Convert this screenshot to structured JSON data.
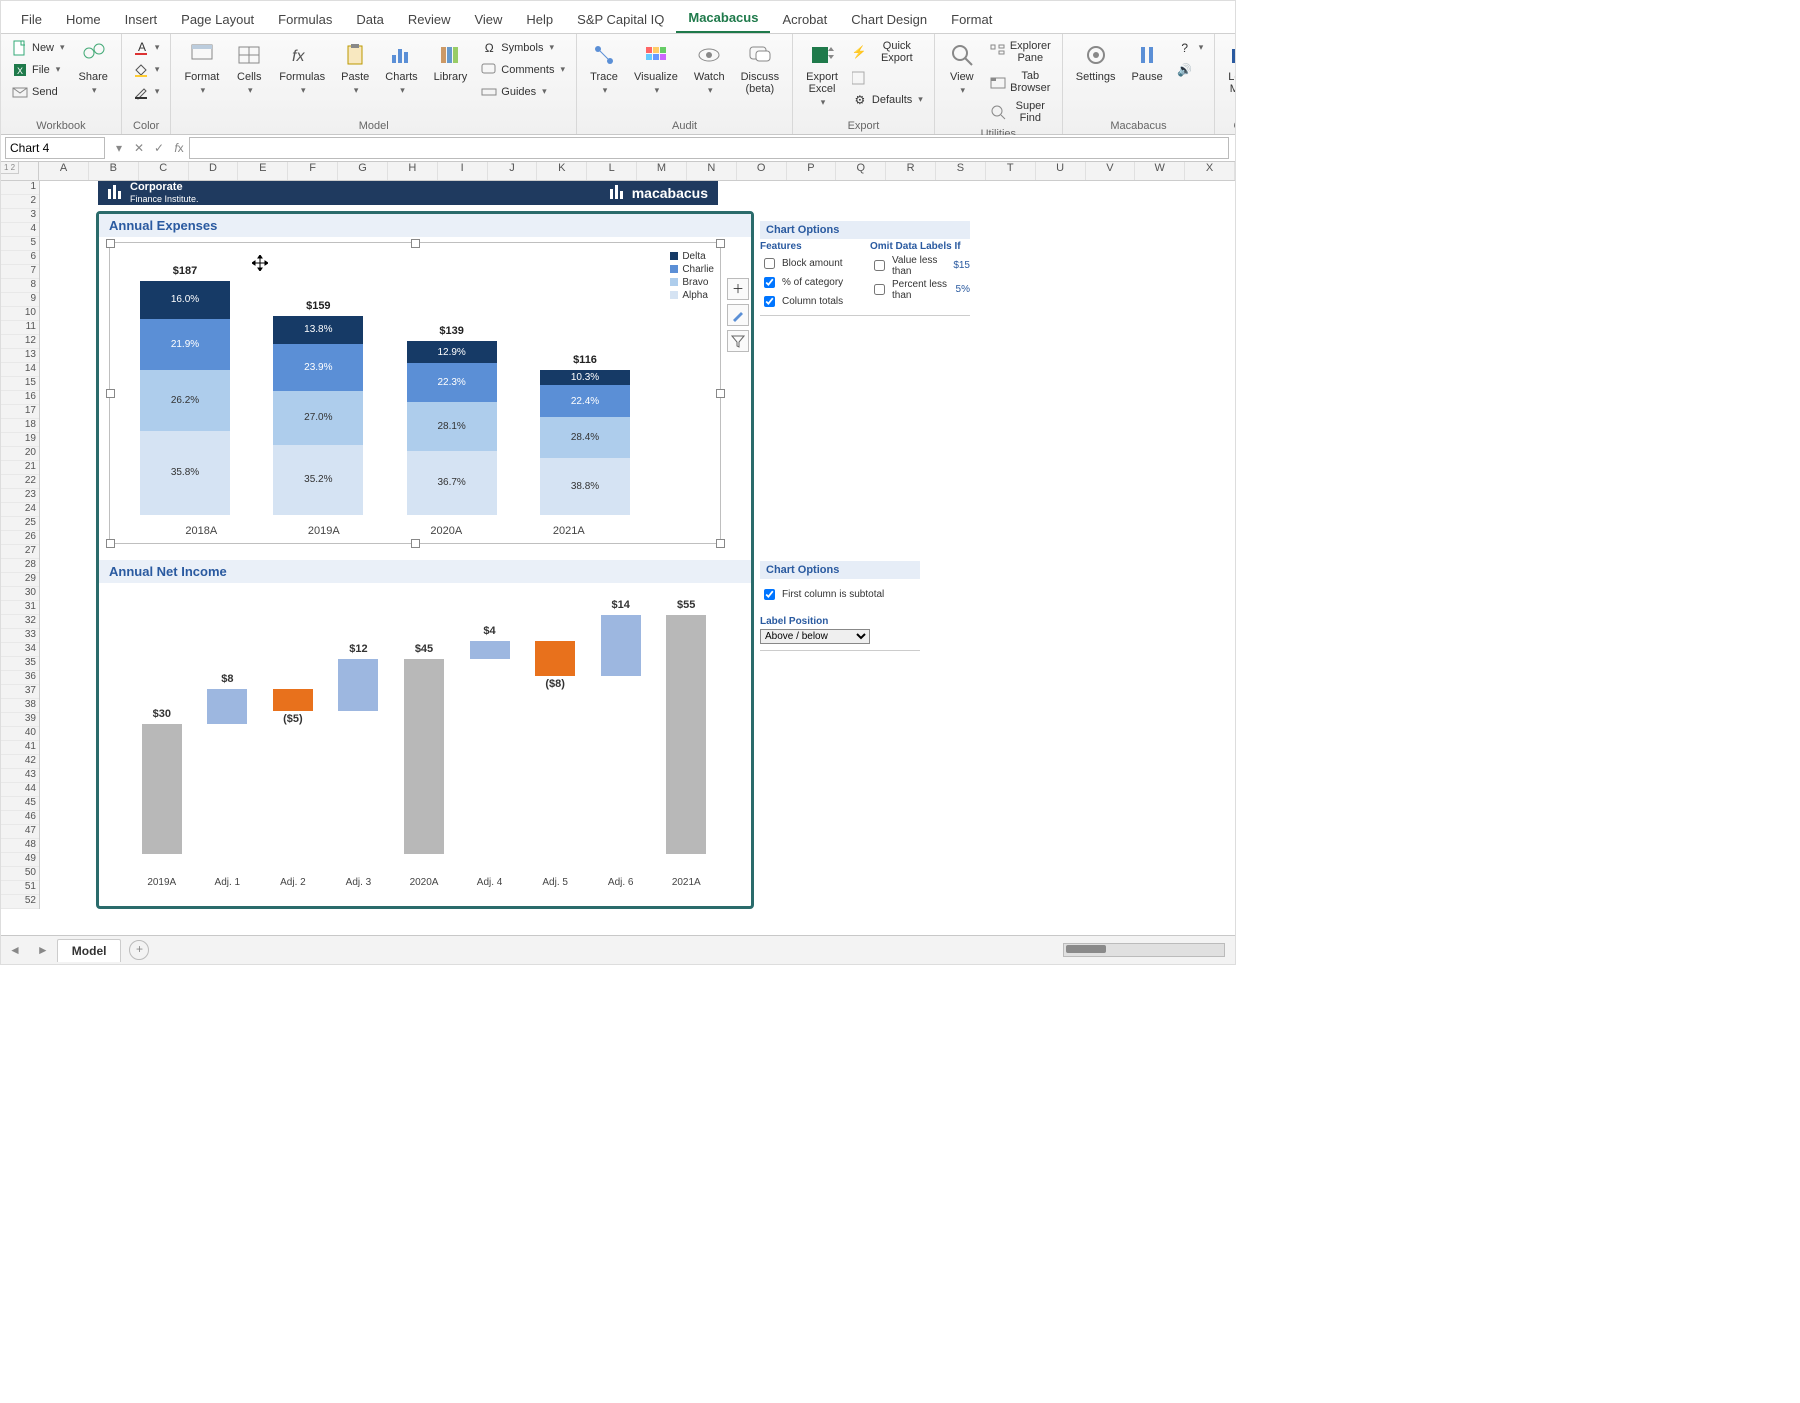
{
  "menubar": [
    "File",
    "Home",
    "Insert",
    "Page Layout",
    "Formulas",
    "Data",
    "Review",
    "View",
    "Help",
    "S&P Capital IQ",
    "Macabacus",
    "Acrobat",
    "Chart Design",
    "Format"
  ],
  "menubar_active": "Macabacus",
  "ribbon": {
    "groups": {
      "workbook": {
        "label": "Workbook",
        "new": "New",
        "file": "File",
        "send": "Send",
        "share": "Share"
      },
      "color": {
        "label": "Color"
      },
      "model": {
        "label": "Model",
        "format": "Format",
        "cells": "Cells",
        "formulas": "Formulas",
        "paste": "Paste",
        "charts": "Charts",
        "library": "Library",
        "symbols": "Symbols",
        "comments": "Comments",
        "guides": "Guides"
      },
      "audit": {
        "label": "Audit",
        "trace": "Trace",
        "visualize": "Visualize",
        "watch": "Watch",
        "discuss": "Discuss\n(beta)"
      },
      "export": {
        "label": "Export",
        "exportexcel": "Export\nExcel",
        "quick": "Quick Export",
        "defaults": "Defaults"
      },
      "utilities": {
        "label": "Utilities",
        "view": "View",
        "explorer": "Explorer Pane",
        "tabbrowser": "Tab Browser",
        "superfind": "Super Find"
      },
      "macabacus": {
        "label": "Macabacus",
        "settings": "Settings",
        "pause": "Pause"
      },
      "cfi": {
        "label": "CFI",
        "learn": "Learn\nMore"
      }
    }
  },
  "namebox": "Chart 4",
  "formula": "",
  "columns": [
    "A",
    "B",
    "C",
    "D",
    "E",
    "F",
    "G",
    "H",
    "I",
    "J",
    "K",
    "L",
    "M",
    "N",
    "O",
    "P",
    "Q",
    "R",
    "S",
    "T",
    "U",
    "V",
    "W",
    "X"
  ],
  "rows_count": 52,
  "banner": {
    "left": "Corporate",
    "left2": "Finance Institute.",
    "right": "macabacus"
  },
  "sections": {
    "expenses": "Annual Expenses",
    "netincome": "Annual Net Income"
  },
  "chart1_legend": [
    "Delta",
    "Charlie",
    "Bravo",
    "Alpha"
  ],
  "options1": {
    "title": "Chart Options",
    "features": "Features",
    "omit": "Omit Data Labels If",
    "f_block": "Block amount",
    "f_pct": "% of category",
    "f_totals": "Column totals",
    "o_value": "Value less than",
    "o_pct": "Percent less than",
    "v_value": "$15",
    "v_pct": "5%"
  },
  "options2": {
    "title": "Chart Options",
    "first": "First column is subtotal",
    "labelpos_title": "Label Position",
    "labelpos_value": "Above / below"
  },
  "tabs": {
    "model": "Model"
  },
  "chart_data": [
    {
      "type": "bar",
      "stacked": true,
      "title": "Annual Expenses",
      "categories": [
        "2018A",
        "2019A",
        "2020A",
        "2021A"
      ],
      "series": [
        {
          "name": "Alpha",
          "pct": [
            35.8,
            35.2,
            36.7,
            38.8
          ]
        },
        {
          "name": "Bravo",
          "pct": [
            26.2,
            27.0,
            28.1,
            28.4
          ]
        },
        {
          "name": "Charlie",
          "pct": [
            21.9,
            23.9,
            22.3,
            22.4
          ]
        },
        {
          "name": "Delta",
          "pct": [
            16.0,
            13.8,
            12.9,
            10.3
          ]
        }
      ],
      "totals": [
        187,
        159,
        139,
        116
      ],
      "total_prefix": "$",
      "ylim": [
        0,
        200
      ],
      "colors": {
        "Alpha": "#d5e3f3",
        "Bravo": "#aecdec",
        "Charlie": "#5b8fd6",
        "Delta": "#163a66"
      }
    },
    {
      "type": "waterfall",
      "title": "Annual Net Income",
      "categories": [
        "2019A",
        "Adj. 1",
        "Adj. 2",
        "Adj. 3",
        "2020A",
        "Adj. 4",
        "Adj. 5",
        "Adj. 6",
        "2021A"
      ],
      "values": [
        30,
        8,
        -5,
        12,
        45,
        4,
        -8,
        14,
        55
      ],
      "labels": [
        "$30",
        "$8",
        "($5)",
        "$12",
        "$45",
        "$4",
        "($8)",
        "$14",
        "$55"
      ],
      "is_subtotal": [
        true,
        false,
        false,
        false,
        true,
        false,
        false,
        false,
        true
      ],
      "ylim": [
        0,
        60
      ],
      "colors": {
        "subtotal": "#b8b8b8",
        "positive": "#9db7e0",
        "negative": "#e8711c"
      },
      "first_is_subtotal": true,
      "label_position": "Above / below"
    }
  ]
}
